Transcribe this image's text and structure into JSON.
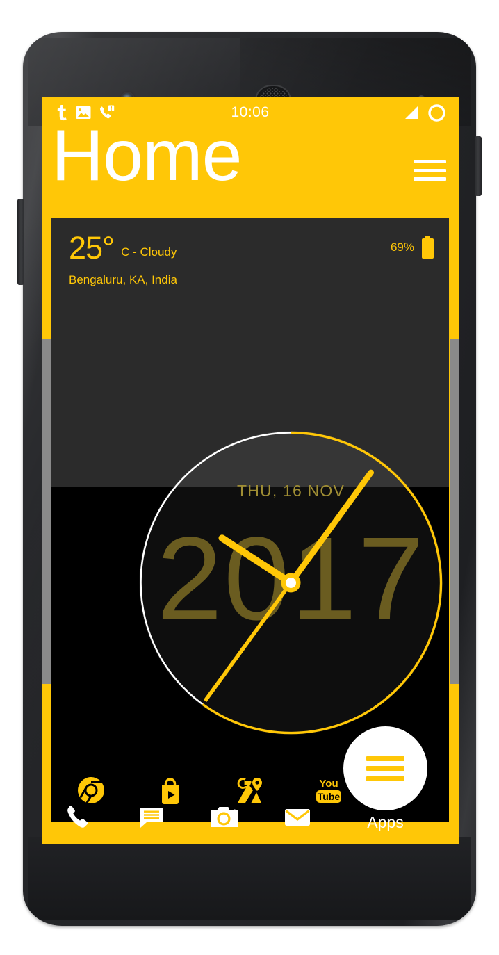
{
  "device": {
    "name": "android-phone"
  },
  "statusbar": {
    "time": "10:06",
    "icons_left": [
      "tumblr-icon",
      "gallery-icon",
      "missed-call-icon"
    ],
    "icons_right": [
      "signal-icon",
      "battery-ring-icon"
    ]
  },
  "header": {
    "title": "Home",
    "menu_icon": "hamburger-menu-icon"
  },
  "weather": {
    "temperature": "25°",
    "condition": "C - Cloudy",
    "location": "Bengaluru,  KA, India",
    "battery_percent": "69%",
    "battery_icon": "battery-icon"
  },
  "clock": {
    "date": "THU, 16 NOV",
    "year": "2017",
    "time_shown": "10:06",
    "hour_angle_deg": -57,
    "minute_angle_deg": 36,
    "second_angle_deg": 216,
    "hand_color": "#FFC707",
    "ring_color": "#FFC707",
    "elapsed_ring_color": "#ffffff"
  },
  "app_shortcuts": [
    {
      "name": "chrome",
      "label": "Chrome"
    },
    {
      "name": "play-store",
      "label": "Play Store"
    },
    {
      "name": "maps",
      "label": "Maps"
    },
    {
      "name": "youtube",
      "label": "YouTube"
    }
  ],
  "dock": [
    {
      "name": "phone",
      "label": "Phone"
    },
    {
      "name": "messages",
      "label": "Messages"
    },
    {
      "name": "camera",
      "label": "Camera"
    },
    {
      "name": "email",
      "label": "Email"
    }
  ],
  "apps_button": {
    "label": "Apps",
    "icon": "apps-drawer-icon"
  },
  "colors": {
    "accent_yellow": "#FFC707",
    "panel_dark": "#2b2b2b",
    "panel_black": "#000000",
    "scrollbar_gray": "#8a8a8a",
    "year_text": "#6a5c20",
    "date_text": "#A08E34"
  }
}
